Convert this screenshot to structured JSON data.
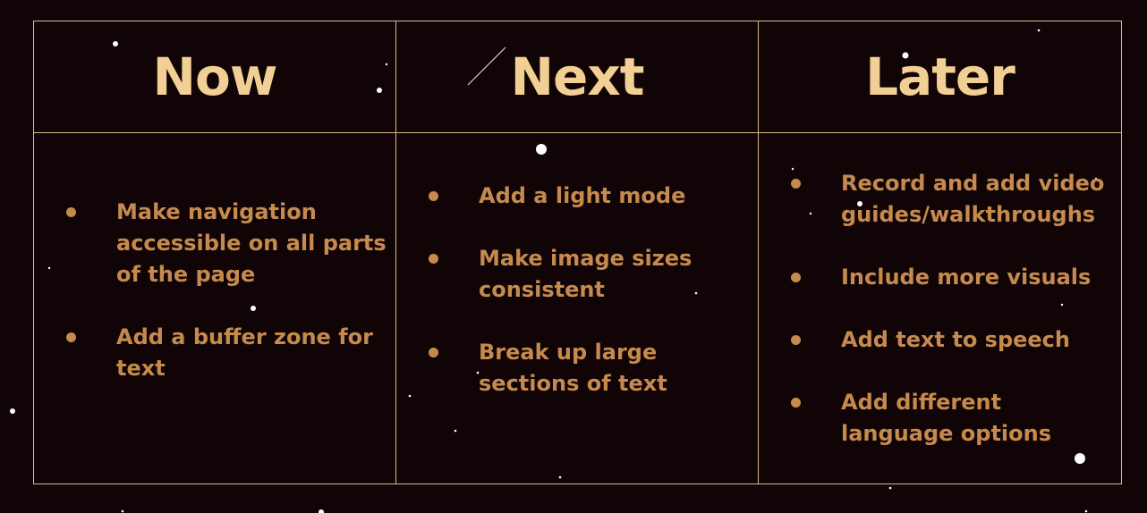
{
  "board": {
    "columns": [
      {
        "title": "Now",
        "items": [
          "Make navigation accessible on all parts of the page",
          "Add a buffer zone for text"
        ]
      },
      {
        "title": "Next",
        "items": [
          "Add a light mode",
          "Make image sizes consistent",
          "Break up large sections of text"
        ]
      },
      {
        "title": "Later",
        "items": [
          "Record and add video guides/walkthroughs",
          "Include more visuals",
          "Add text to speech",
          "Add different language options"
        ]
      }
    ]
  },
  "colors": {
    "background": "#110406",
    "border": "#d9b88a",
    "heading": "#f2cf95",
    "item_text": "#c68a4e"
  }
}
